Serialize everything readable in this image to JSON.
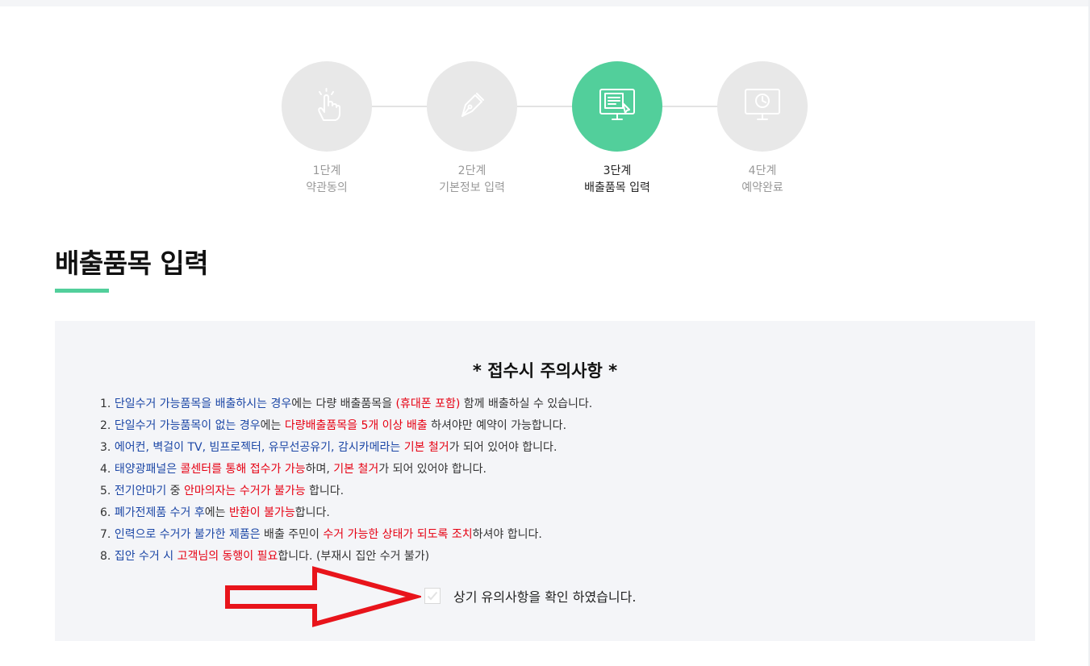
{
  "steps": [
    {
      "number": "1단계",
      "name": "약관동의",
      "icon": "pointing-hand-icon",
      "active": false
    },
    {
      "number": "2단계",
      "name": "기본정보 입력",
      "icon": "pen-nib-icon",
      "active": false
    },
    {
      "number": "3단계",
      "name": "배출품목 입력",
      "icon": "monitor-form-icon",
      "active": true
    },
    {
      "number": "4단계",
      "name": "예약완료",
      "icon": "monitor-clock-icon",
      "active": false
    }
  ],
  "page_title": "배출품목 입력",
  "notice": {
    "heading": "*  접수시 주의사항  *",
    "items": [
      [
        {
          "t": "1. ",
          "c": ""
        },
        {
          "t": "단일수거 가능품목을 배출하시는 경우",
          "c": "blue"
        },
        {
          "t": "에는 다량 배출품목을 ",
          "c": ""
        },
        {
          "t": "(휴대폰 포함)",
          "c": "red"
        },
        {
          "t": " 함께 배출하실 수 있습니다.",
          "c": ""
        }
      ],
      [
        {
          "t": "2. ",
          "c": ""
        },
        {
          "t": "단일수거 가능품목이 없는 경우",
          "c": "blue"
        },
        {
          "t": "에는 ",
          "c": ""
        },
        {
          "t": "다량배출품목을 5개 이상 배출",
          "c": "red"
        },
        {
          "t": " 하셔야만 예약이 가능합니다.",
          "c": ""
        }
      ],
      [
        {
          "t": "3. ",
          "c": ""
        },
        {
          "t": "에어컨, 벽걸이 TV, 빔프로젝터, 유무선공유기, 감시카메라는",
          "c": "blue"
        },
        {
          "t": " ",
          "c": ""
        },
        {
          "t": "기본 철거",
          "c": "red"
        },
        {
          "t": "가 되어 있어야 합니다.",
          "c": ""
        }
      ],
      [
        {
          "t": "4. ",
          "c": ""
        },
        {
          "t": "태양광패널은",
          "c": "blue"
        },
        {
          "t": " ",
          "c": ""
        },
        {
          "t": "콜센터를 통해 접수가 가능",
          "c": "red"
        },
        {
          "t": "하며, ",
          "c": ""
        },
        {
          "t": "기본 철거",
          "c": "red"
        },
        {
          "t": "가 되어 있어야 합니다.",
          "c": ""
        }
      ],
      [
        {
          "t": "5. ",
          "c": ""
        },
        {
          "t": "전기안마기",
          "c": "blue"
        },
        {
          "t": " 중 ",
          "c": ""
        },
        {
          "t": "안마의자는 수거가 불가능",
          "c": "red"
        },
        {
          "t": " 합니다.",
          "c": ""
        }
      ],
      [
        {
          "t": "6. ",
          "c": ""
        },
        {
          "t": "폐가전제품 수거 후",
          "c": "blue"
        },
        {
          "t": "에는 ",
          "c": ""
        },
        {
          "t": "반환이 불가능",
          "c": "red"
        },
        {
          "t": "합니다.",
          "c": ""
        }
      ],
      [
        {
          "t": "7. ",
          "c": ""
        },
        {
          "t": "인력으로 수거가 불가한 제품은",
          "c": "blue"
        },
        {
          "t": " 배출 주민이 ",
          "c": ""
        },
        {
          "t": "수거 가능한 상태가 되도록 조치",
          "c": "red"
        },
        {
          "t": "하셔야 합니다.",
          "c": ""
        }
      ],
      [
        {
          "t": "8. ",
          "c": ""
        },
        {
          "t": "집안 수거 시",
          "c": "blue"
        },
        {
          "t": " ",
          "c": ""
        },
        {
          "t": "고객님의 동행이 필요",
          "c": "red"
        },
        {
          "t": "합니다. (부재시 집안 수거 불가)",
          "c": ""
        }
      ]
    ],
    "confirm_label": "상기 유의사항을 확인 하였습니다.",
    "confirm_checked": false
  },
  "colors": {
    "accent": "#52cf9b",
    "blue_text": "#1c47a6",
    "red_text": "#e60012",
    "annotation_arrow": "#e8141b"
  },
  "annotation": {
    "icon": "red-arrow-icon"
  }
}
